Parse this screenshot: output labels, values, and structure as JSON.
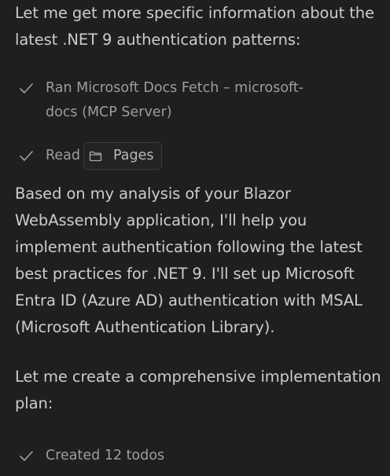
{
  "chat": {
    "intro_text": "Let me get more specific information about the latest .NET 9 authentication patterns:",
    "tool_ran": {
      "icon": "check-icon",
      "label": "Ran Microsoft Docs Fetch – microsoft-docs (MCP Server)"
    },
    "tool_read": {
      "icon": "check-icon",
      "label": "Read",
      "pill_icon": "folder-icon",
      "pill_label": "Pages"
    },
    "analysis_text": "Based on my analysis of your Blazor WebAssembly application, I'll help you implement authentication following the latest best practices for .NET 9. I'll set up Microsoft Entra ID (Azure AD) authentication with MSAL (Microsoft Authentication Library).",
    "plan_text": "Let me create a comprehensive implementation plan:",
    "tool_created": {
      "icon": "check-icon",
      "label": "Created 12 todos"
    }
  },
  "colors": {
    "background": "#1f1f1f",
    "text": "#cccccc",
    "muted_text": "#9d9d9d",
    "pill_border": "#3a3a3a"
  }
}
